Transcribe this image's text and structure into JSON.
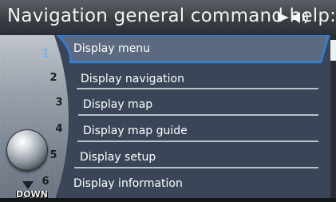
{
  "header": {
    "title": "Navigation general command help:",
    "voice_indicator": "speaker-icon"
  },
  "dial": {
    "down_label": "DOWN",
    "numbers": [
      "1",
      "2",
      "3",
      "4",
      "5",
      "6"
    ]
  },
  "menu": {
    "items": [
      {
        "label": "Display menu",
        "selected": true
      },
      {
        "label": "Display navigation",
        "selected": false
      },
      {
        "label": "Display map",
        "selected": false
      },
      {
        "label": "Display map guide",
        "selected": false
      },
      {
        "label": "Display setup",
        "selected": false
      },
      {
        "label": "Display information",
        "selected": false
      }
    ]
  },
  "colors": {
    "highlight_border": "#2f7fd6",
    "selected_fill": "#5b6a80",
    "panel_fill": "#3a4658",
    "row_divider": "#e6e9ee"
  }
}
